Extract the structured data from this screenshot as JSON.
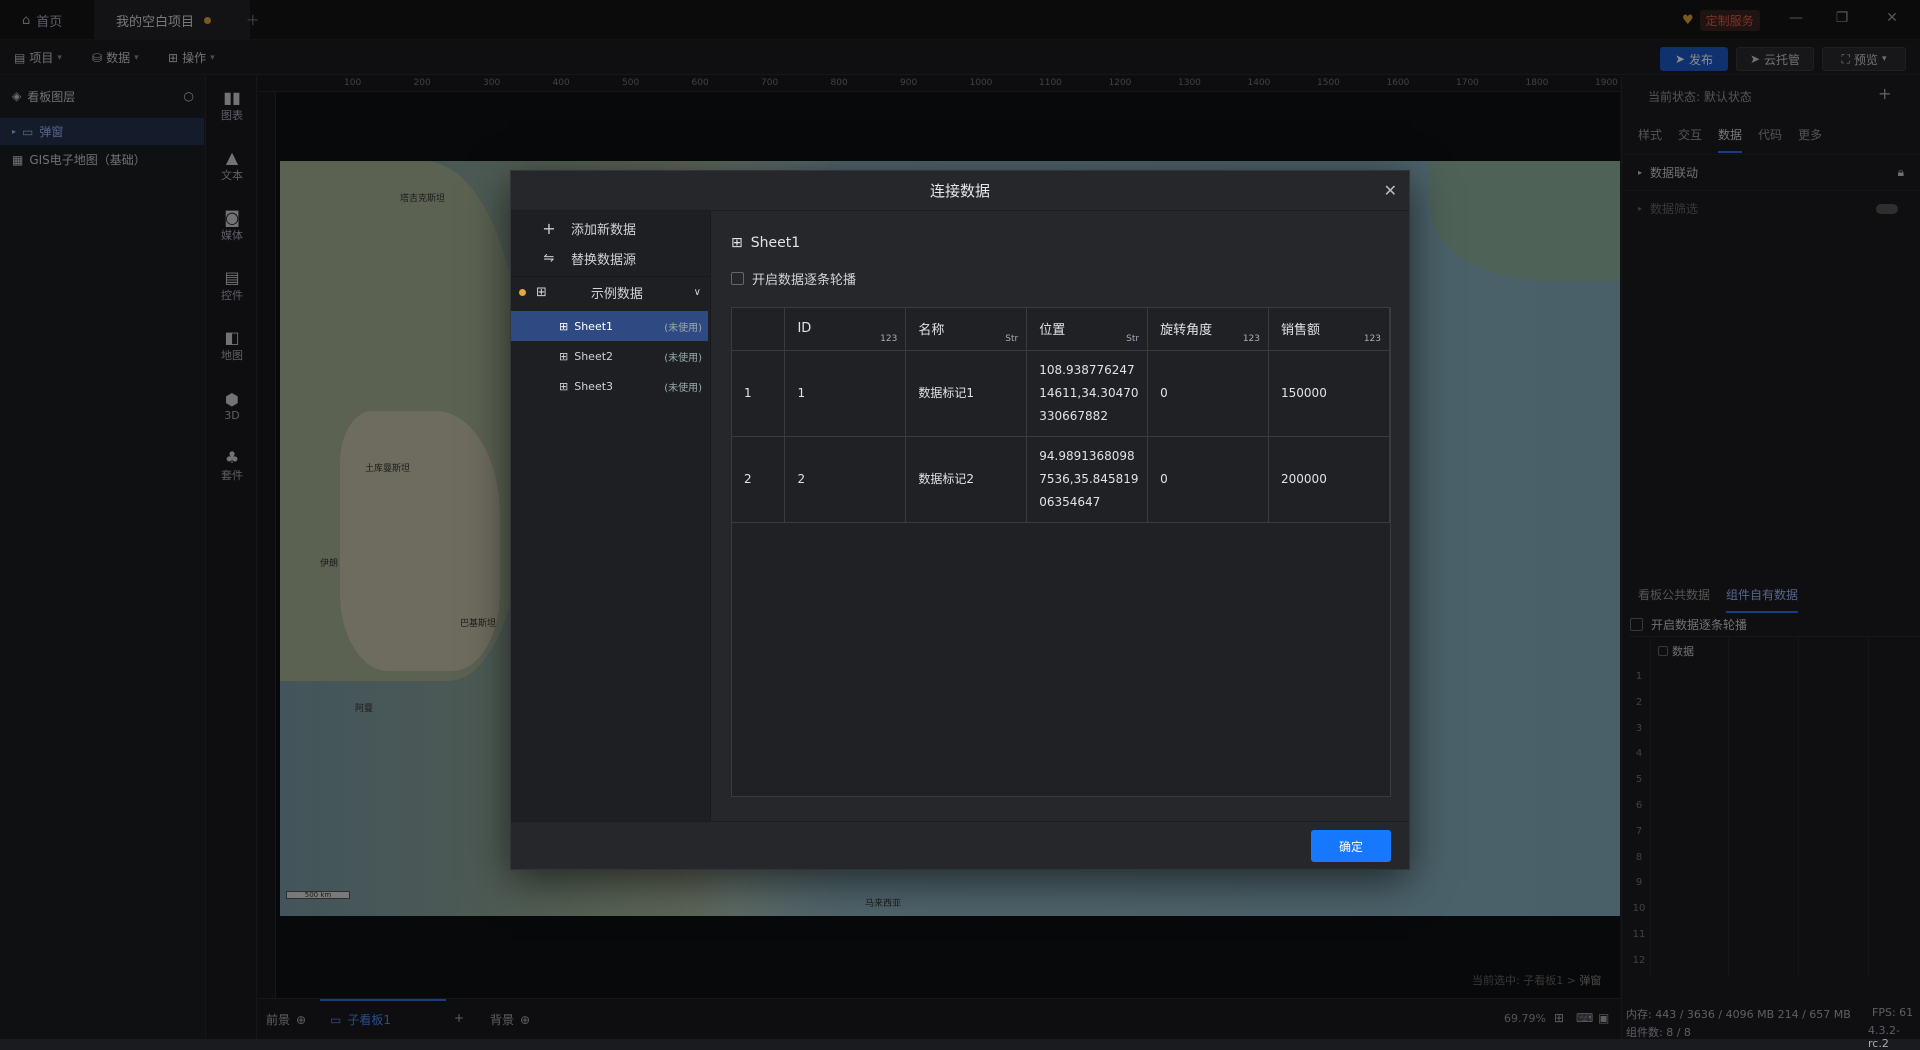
{
  "titlebar": {
    "home_tab": "首页",
    "project_tab": "我的空白项目",
    "custom_service": "定制服务"
  },
  "toolbar": {
    "menu_project": "项目",
    "menu_data": "数据",
    "menu_ops": "操作",
    "publish": "发布",
    "cloud_host": "云托管",
    "preview": "预览"
  },
  "layers": {
    "title": "看板图层",
    "items": [
      {
        "label": "弹窗"
      },
      {
        "label": "GIS电子地图（基础）"
      }
    ]
  },
  "rail": {
    "items": [
      {
        "label": "图表",
        "icon": "chart-icon"
      },
      {
        "label": "文本",
        "icon": "text-icon"
      },
      {
        "label": "媒体",
        "icon": "media-icon"
      },
      {
        "label": "控件",
        "icon": "control-icon"
      },
      {
        "label": "地图",
        "icon": "map-icon"
      },
      {
        "label": "3D",
        "icon": "cube-icon"
      },
      {
        "label": "套件",
        "icon": "kit-icon"
      }
    ]
  },
  "canvas": {
    "ruler_top": [
      "100",
      "200",
      "300",
      "400",
      "500",
      "600",
      "700",
      "800",
      "900",
      "1000",
      "1100",
      "1200",
      "1300",
      "1400",
      "1500",
      "1600",
      "1700",
      "1800",
      "1900"
    ],
    "map_labels": [
      "塔吉克斯坦",
      "土库曼斯坦",
      "伊朗",
      "阿曼",
      "巴基斯坦",
      "马来西亚"
    ],
    "scale": "500 km",
    "selection_prefix": "当前选中: 子看板1 > ",
    "selection_target": "弹窗"
  },
  "bottombar": {
    "front": "前景",
    "sub": "子看板1",
    "back": "背景",
    "zoom": "69.79%"
  },
  "rpanel": {
    "state_label": "当前状态:",
    "state_value": "默认状态",
    "tabs": [
      "样式",
      "交互",
      "数据",
      "代码",
      "更多"
    ],
    "rows": [
      "数据联动",
      "数据筛选"
    ],
    "bottom_tabs": [
      "看板公共数据",
      "组件自有数据"
    ],
    "carousel": "开启数据逐条轮播",
    "grid_header": "数据",
    "row_numbers": [
      "1",
      "2",
      "3",
      "4",
      "5",
      "6",
      "7",
      "8",
      "9",
      "10",
      "11",
      "12"
    ],
    "memory": "内存: 443 / 3636 / 4096 MB  214 / 657 MB",
    "fps": "FPS: 61",
    "components": "组件数: 8 / 8",
    "version": "4.3.2-rc.2"
  },
  "modal": {
    "title": "连接数据",
    "add_data": "添加新数据",
    "replace_source": "替换数据源",
    "group": "示例数据",
    "sheets": [
      {
        "name": "Sheet1",
        "tag": "(未使用)"
      },
      {
        "name": "Sheet2",
        "tag": "(未使用)"
      },
      {
        "name": "Sheet3",
        "tag": "(未使用)"
      }
    ],
    "sheet_title": "Sheet1",
    "carousel_label": "开启数据逐条轮播",
    "columns": [
      {
        "name": "",
        "type": ""
      },
      {
        "name": "ID",
        "type": "123"
      },
      {
        "name": "名称",
        "type": "Str"
      },
      {
        "name": "位置",
        "type": "Str"
      },
      {
        "name": "旋转角度",
        "type": "123"
      },
      {
        "name": "销售额",
        "type": "123"
      }
    ],
    "rows": [
      {
        "idx": "1",
        "id": "1",
        "name": "数据标记1",
        "pos": "108.93877624714611,34.30470330667882",
        "angle": "0",
        "sales": "150000"
      },
      {
        "idx": "2",
        "id": "2",
        "name": "数据标记2",
        "pos": "94.98913680987536,35.84581906354647",
        "angle": "0",
        "sales": "200000"
      }
    ],
    "ok": "确定"
  }
}
